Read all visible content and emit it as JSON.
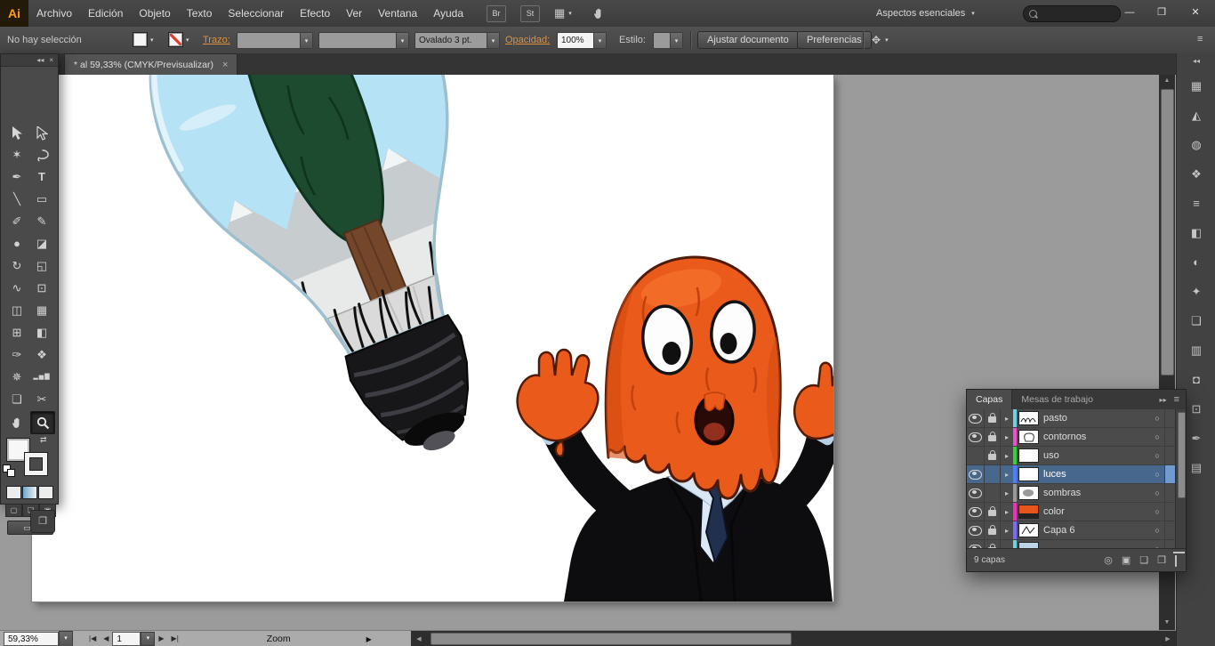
{
  "menubar": {
    "logo": "Ai",
    "items": [
      "Archivo",
      "Edición",
      "Objeto",
      "Texto",
      "Seleccionar",
      "Efecto",
      "Ver",
      "Ventana",
      "Ayuda"
    ],
    "bridge": "Br",
    "stock": "St",
    "arrange_icon": "▦",
    "caret": "▾",
    "workspace": "Aspectos esenciales",
    "search_value": ""
  },
  "window_controls": {
    "minimize": "—",
    "restore": "❐",
    "close": "✕"
  },
  "controlbar": {
    "status": "No hay selección",
    "stroke_label": "Trazo:",
    "brush": "Ovalado 3 pt.",
    "opacity_label": "Opacidad:",
    "opacity": "100%",
    "style_label": "Estilo:",
    "fit_button": "Ajustar documento",
    "prefs_button": "Preferencias",
    "extra_icon": "✥",
    "menu_icon": "≡"
  },
  "doc_tab": {
    "title": "* al 59,33% (CMYK/Previsualizar)",
    "close": "×"
  },
  "tool_panel": {
    "collapse": "◂◂",
    "close": "×",
    "tools": [
      {
        "name": "selection",
        "glyph": ""
      },
      {
        "name": "direct-selection",
        "glyph": ""
      },
      {
        "name": "magic-wand",
        "glyph": "✶"
      },
      {
        "name": "lasso",
        "glyph": ""
      },
      {
        "name": "pen",
        "glyph": "✒"
      },
      {
        "name": "type",
        "glyph": "T"
      },
      {
        "name": "line-segment",
        "glyph": "╲"
      },
      {
        "name": "rectangle",
        "glyph": "▭"
      },
      {
        "name": "paintbrush",
        "glyph": "✐"
      },
      {
        "name": "pencil",
        "glyph": "✎"
      },
      {
        "name": "blob-brush",
        "glyph": "●"
      },
      {
        "name": "eraser",
        "glyph": "◪"
      },
      {
        "name": "rotate",
        "glyph": "↻"
      },
      {
        "name": "scale",
        "glyph": "◱"
      },
      {
        "name": "width",
        "glyph": "∿"
      },
      {
        "name": "free-transform",
        "glyph": "⊡"
      },
      {
        "name": "shape-builder",
        "glyph": "◫"
      },
      {
        "name": "perspective-grid",
        "glyph": "▦"
      },
      {
        "name": "mesh",
        "glyph": "⊞"
      },
      {
        "name": "gradient",
        "glyph": "◧"
      },
      {
        "name": "eyedropper",
        "glyph": "✑"
      },
      {
        "name": "blend",
        "glyph": "❖"
      },
      {
        "name": "symbol-sprayer",
        "glyph": "✵"
      },
      {
        "name": "column-graph",
        "glyph": "▂▅▇"
      },
      {
        "name": "artboard",
        "glyph": "❏"
      },
      {
        "name": "slice",
        "glyph": "✂"
      },
      {
        "name": "hand",
        "glyph": ""
      },
      {
        "name": "zoom",
        "glyph": ""
      }
    ],
    "swap_icon": "⇄",
    "mode_normal": "▢",
    "mode_behind": "❏",
    "mode_inside": "▣",
    "screen_mode_glyph": "▭ ▾",
    "floating_icon": "❐"
  },
  "dock": {
    "collapse": "◂◂",
    "icons": [
      {
        "name": "color",
        "glyph": "▦"
      },
      {
        "name": "color-guide",
        "glyph": "◭"
      },
      {
        "name": "appearance",
        "glyph": "◍"
      },
      {
        "name": "graphic-styles",
        "glyph": "❖"
      },
      {
        "name": "stroke",
        "glyph": "≡"
      },
      {
        "name": "gradient",
        "glyph": "◧"
      },
      {
        "name": "transparency",
        "glyph": "◐"
      },
      {
        "name": "symbols",
        "glyph": "✦"
      },
      {
        "name": "artboards",
        "glyph": "❏"
      },
      {
        "name": "align",
        "glyph": "▥"
      },
      {
        "name": "pathfinder",
        "glyph": "◘"
      },
      {
        "name": "transform",
        "glyph": "⊡"
      },
      {
        "name": "brushes",
        "glyph": "✒"
      },
      {
        "name": "swatches",
        "glyph": "▤"
      }
    ]
  },
  "layers_panel": {
    "tab_layers": "Capas",
    "tab_artboards": "Mesas de trabajo",
    "collapse": "▸▸",
    "menu": "≡",
    "expand": "▸",
    "target": "○",
    "rows": [
      {
        "name": "pasto",
        "color": "#6fd3e8",
        "eye": true,
        "lock": true,
        "selected": false
      },
      {
        "name": "contornos",
        "color": "#f04fd0",
        "eye": true,
        "lock": true,
        "selected": false
      },
      {
        "name": "uso",
        "color": "#35d23c",
        "eye": false,
        "lock": true,
        "selected": false
      },
      {
        "name": "luces",
        "color": "#4f7dff",
        "eye": true,
        "lock": false,
        "selected": true
      },
      {
        "name": "sombras",
        "color": "#9a9a9a",
        "eye": true,
        "lock": false,
        "selected": false
      },
      {
        "name": "color",
        "color": "#f02fc2",
        "eye": true,
        "lock": true,
        "selected": false
      },
      {
        "name": "Capa 6",
        "color": "#7a6cff",
        "eye": true,
        "lock": true,
        "selected": false
      },
      {
        "name": "",
        "color": "#6fd3e8",
        "eye": true,
        "lock": true,
        "selected": false
      }
    ],
    "count": "9 capas",
    "buttons": {
      "locate": "◎",
      "clip_mask": "▣",
      "new_sublayer": "❏",
      "new_layer": "❐"
    }
  },
  "statusbar": {
    "zoom": "59,33%",
    "nav_first": "|◀",
    "nav_prev": "◀",
    "artboard_field": "1",
    "nav_next": "▶",
    "nav_last": "▶|",
    "display": "Zoom",
    "display_arrow": "▶"
  },
  "scrollbars": {
    "up": "▲",
    "down": "▼",
    "left": "◀",
    "right": "▶"
  }
}
